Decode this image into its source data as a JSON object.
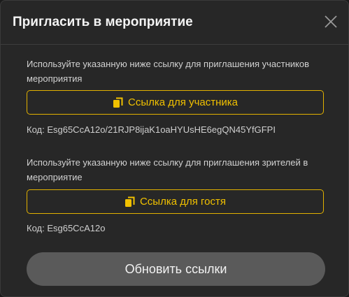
{
  "dialog": {
    "title": "Пригласить в мероприятие",
    "close_icon": "close-icon"
  },
  "participant": {
    "description": "Используйте указанную ниже ссылку для приглашения участников мероприятия",
    "button_label": "Ссылка для участника",
    "code": "Код: Esg65CcA12o/21RJP8ijaK1oaHYUsHE6egQN45YfGFPI"
  },
  "guest": {
    "description": "Используйте указанную ниже ссылку для приглашения зрителей в мероприятие",
    "button_label": "Ссылка для гостя",
    "code": "Код: Esg65CcA12o"
  },
  "refresh_button": "Обновить ссылки",
  "colors": {
    "accent": "#f1c100",
    "background": "#272727",
    "button_bg": "#5a5a5a"
  },
  "icons": {
    "copy": "copy-icon",
    "close": "close-icon"
  }
}
